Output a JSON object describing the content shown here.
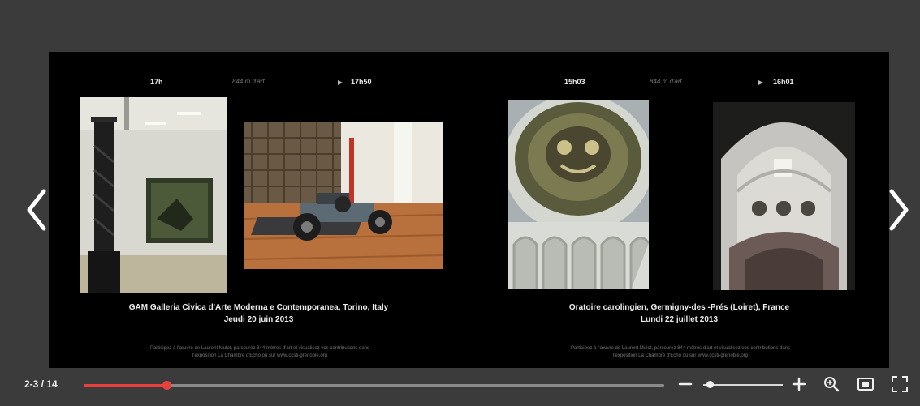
{
  "viewer": {
    "pages": [
      {
        "time_start": "17h",
        "distance": "844 m d'art",
        "time_end": "17h50",
        "caption_line1": "GAM Galleria Civica d'Arte Moderna e Contemporanea, Torino, Italy",
        "caption_line2": "Jeudi 20 juin 2013",
        "credit_line1": "Participez à l'œuvre de Laurent Mulot, parcourez 844 mètres d'art et visualisez vos contributions dans",
        "credit_line2": "l'exposition La Chambre d'Echo ou sur www.ccsti-grenoble.org",
        "photos": [
          "gallery-sculpture-photo",
          "race-car-exhibit-photo"
        ]
      },
      {
        "time_start": "15h03",
        "distance": "844 m d'art",
        "time_end": "16h01",
        "caption_line1": "Oratoire carolingien, Germigny-des -Prés (Loiret), France",
        "caption_line2": "Lundi 22 juillet 2013",
        "credit_line1": "Participez à l'œuvre de Laurent Mulot, parcourez 844 mètres d'art et visualisez vos contributions dans",
        "credit_line2": "l'exposition La Chambre d'Echo ou sur www.ccsti-grenoble.org",
        "photos": [
          "dome-mosaic-photo",
          "vaulted-apse-photo"
        ]
      }
    ]
  },
  "toolbar": {
    "page_counter": "2-3 / 14",
    "progress_fraction": 0.143,
    "zoom_fraction": 0.08
  },
  "icons": [
    "chevron-left-icon",
    "chevron-right-icon",
    "minus-icon",
    "plus-icon",
    "magnifier-icon",
    "single-page-icon",
    "fullscreen-icon"
  ],
  "colors": {
    "frame": "#3b3b3b",
    "spread": "#000000",
    "progress_accent": "#e9403c",
    "text": "#f2f2f2"
  }
}
